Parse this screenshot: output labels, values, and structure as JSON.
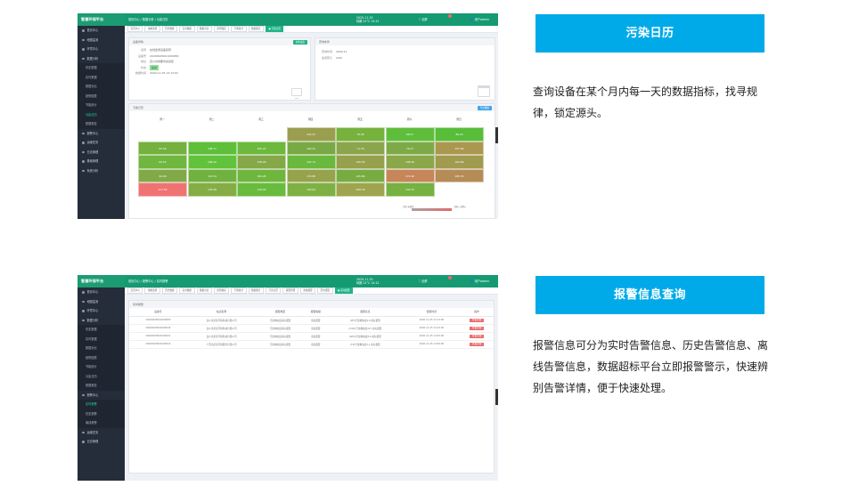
{
  "app": {
    "name": "智慧环保平台",
    "user": "用户admin",
    "fullscreen": "全屏",
    "top_info_line1": "2020-11-25",
    "top_info_line2": "晴朗 22°C 14:12"
  },
  "sidebar": {
    "items": [
      {
        "label": "首页中心",
        "sub": false,
        "on": false
      },
      {
        "label": "地图监测",
        "sub": false,
        "on": false
      },
      {
        "label": "环境中心",
        "sub": false,
        "on": false
      },
      {
        "label": "数据分析",
        "sub": false,
        "on": false
      },
      {
        "label": "历史数据",
        "sub": true,
        "on": false
      },
      {
        "label": "实时数据",
        "sub": true,
        "on": false
      },
      {
        "label": "数据对比",
        "sub": true,
        "on": false
      },
      {
        "label": "趋势图表",
        "sub": true,
        "on": false
      },
      {
        "label": "节能统计",
        "sub": true,
        "on": false
      },
      {
        "label": "污染日历",
        "sub": true,
        "on": true
      },
      {
        "label": "数据报告",
        "sub": true,
        "on": false
      },
      {
        "label": "报警中心",
        "sub": false,
        "on": false
      },
      {
        "label": "运维任务",
        "sub": false,
        "on": false
      },
      {
        "label": "日志管理",
        "sub": false,
        "on": false
      },
      {
        "label": "基础管理",
        "sub": false,
        "on": false
      },
      {
        "label": "系统分析",
        "sub": false,
        "on": false
      }
    ]
  },
  "sidebar2": {
    "items": [
      {
        "label": "首页中心",
        "sub": false,
        "on": false
      },
      {
        "label": "地图监测",
        "sub": false,
        "on": false
      },
      {
        "label": "环境中心",
        "sub": false,
        "on": false
      },
      {
        "label": "数据分析",
        "sub": false,
        "on": false
      },
      {
        "label": "历史数据",
        "sub": true,
        "on": false
      },
      {
        "label": "实时数据",
        "sub": true,
        "on": false
      },
      {
        "label": "数据对比",
        "sub": true,
        "on": false
      },
      {
        "label": "趋势图表",
        "sub": true,
        "on": false
      },
      {
        "label": "节能统计",
        "sub": true,
        "on": false
      },
      {
        "label": "污染日历",
        "sub": true,
        "on": false
      },
      {
        "label": "数据报告",
        "sub": true,
        "on": false
      },
      {
        "label": "报警中心",
        "sub": false,
        "on": false
      },
      {
        "label": "实时报警",
        "sub": true,
        "on": true
      },
      {
        "label": "历史报警",
        "sub": true,
        "on": false
      },
      {
        "label": "离线报警",
        "sub": true,
        "on": false
      },
      {
        "label": "运维任务",
        "sub": false,
        "on": false
      },
      {
        "label": "日志管理",
        "sub": false,
        "on": false
      }
    ]
  },
  "shot1": {
    "crumb": "首页中心 / 数据分析 / 污染日历",
    "tags": [
      {
        "label": "首页中心",
        "on": false
      },
      {
        "label": "地图监测",
        "on": false
      },
      {
        "label": "历史数据",
        "on": false
      },
      {
        "label": "实时数据",
        "on": false
      },
      {
        "label": "数据对比",
        "on": false
      },
      {
        "label": "趋势图表",
        "on": false
      },
      {
        "label": "节能统计",
        "on": false
      },
      {
        "label": "数据报告",
        "on": false
      },
      {
        "label": "● 污染日历",
        "on": true
      }
    ],
    "device_card": {
      "title": "设备详情",
      "button": "切换设备",
      "rows": [
        {
          "k": "名称",
          "v": "在线监测设备名称"
        },
        {
          "k": "设备号",
          "v": "20200925001000056"
        },
        {
          "k": "地址",
          "v": "四川省成都市某某区"
        },
        {
          "k": "状态",
          "v": "在线"
        },
        {
          "k": "数据时间",
          "v": "2020-11-25 14:13:02"
        }
      ]
    },
    "query_card": {
      "title": "查询条件",
      "rows": [
        {
          "k": "查询时间",
          "v": "2020-11"
        },
        {
          "k": "监测因子",
          "v": "COD"
        }
      ]
    },
    "calendar": {
      "title": "污染日历",
      "button": "导出数据",
      "weekdays": [
        "周一",
        "周二",
        "周三",
        "周四",
        "周五",
        "周六",
        "周日"
      ],
      "cells": [
        {
          "r": 0,
          "c": 3,
          "v": "101.22",
          "color": "#9a9f4f"
        },
        {
          "r": 0,
          "c": 4,
          "v": "76.09",
          "color": "#76b23c"
        },
        {
          "r": 0,
          "c": 5,
          "v": "88.57",
          "color": "#5fbd3c"
        },
        {
          "r": 0,
          "c": 6,
          "v": "86.20",
          "color": "#58bd39"
        },
        {
          "r": 1,
          "c": 0,
          "v": "93.46",
          "color": "#74b13f"
        },
        {
          "r": 1,
          "c": 1,
          "v": "108.71",
          "color": "#5fbe3a"
        },
        {
          "r": 1,
          "c": 2,
          "v": "105.22",
          "color": "#6cb93e"
        },
        {
          "r": 1,
          "c": 3,
          "v": "100.21",
          "color": "#79a945"
        },
        {
          "r": 1,
          "c": 4,
          "v": "71.76",
          "color": "#8ba54c"
        },
        {
          "r": 1,
          "c": 5,
          "v": "70.27",
          "color": "#7daa47"
        },
        {
          "r": 1,
          "c": 6,
          "v": "157.00",
          "color": "#aa9750"
        },
        {
          "r": 2,
          "c": 0,
          "v": "94.53",
          "color": "#6fb73f"
        },
        {
          "r": 2,
          "c": 1,
          "v": "106.22",
          "color": "#61c33b"
        },
        {
          "r": 2,
          "c": 2,
          "v": "138.29",
          "color": "#85a849"
        },
        {
          "r": 2,
          "c": 3,
          "v": "142.74",
          "color": "#6ab83d"
        },
        {
          "r": 2,
          "c": 4,
          "v": "140.30",
          "color": "#95a14d"
        },
        {
          "r": 2,
          "c": 5,
          "v": "148.40",
          "color": "#8aa74a"
        },
        {
          "r": 2,
          "c": 6,
          "v": "164.89",
          "color": "#a19b50"
        },
        {
          "r": 3,
          "c": 0,
          "v": "94.48",
          "color": "#82a948"
        },
        {
          "r": 3,
          "c": 1,
          "v": "110.34",
          "color": "#70b13f"
        },
        {
          "r": 3,
          "c": 2,
          "v": "100.28",
          "color": "#6fb63f"
        },
        {
          "r": 3,
          "c": 3,
          "v": "170.88",
          "color": "#97a24c"
        },
        {
          "r": 3,
          "c": 4,
          "v": "145.80",
          "color": "#78ac43"
        },
        {
          "r": 3,
          "c": 5,
          "v": "172.40",
          "color": "#c6865a"
        },
        {
          "r": 3,
          "c": 6,
          "v": "185.53",
          "color": "#b58c56"
        },
        {
          "r": 4,
          "c": 0,
          "v": "217.50",
          "color": "#f07373"
        },
        {
          "r": 4,
          "c": 1,
          "v": "135.58",
          "color": "#85ad45"
        },
        {
          "r": 4,
          "c": 2,
          "v": "119.20",
          "color": "#69bb3d"
        },
        {
          "r": 4,
          "c": 3,
          "v": "140.64",
          "color": "#7fb044"
        },
        {
          "r": 4,
          "c": 4,
          "v": "208.78",
          "color": "#9ea54e"
        },
        {
          "r": 4,
          "c": 5,
          "v": "134.52",
          "color": "#76b141"
        }
      ],
      "legend_low": "合格 未超标",
      "legend_high": "超标 已超标"
    }
  },
  "shot2": {
    "crumb": "首页中心 / 报警中心 / 实时报警",
    "tags": [
      {
        "label": "首页中心",
        "on": false
      },
      {
        "label": "地图监测",
        "on": false
      },
      {
        "label": "历史数据",
        "on": false
      },
      {
        "label": "实时数据",
        "on": false
      },
      {
        "label": "数据对比",
        "on": false
      },
      {
        "label": "趋势图表",
        "on": false
      },
      {
        "label": "节能统计",
        "on": false
      },
      {
        "label": "数据报告",
        "on": false
      },
      {
        "label": "污染日历",
        "on": false
      },
      {
        "label": "报警管理",
        "on": false
      },
      {
        "label": "离线报警",
        "on": false
      },
      {
        "label": "历史报警",
        "on": false
      },
      {
        "label": "● 实时报警",
        "on": true
      }
    ],
    "table": {
      "title": "实时报警",
      "columns": [
        "设备号",
        "站点名称",
        "报警类型",
        "报警等级",
        "报警信息",
        "报警时间",
        "操作"
      ],
      "rows": [
        [
          "20200925001000083",
          "四川省某某环保科技有限公司",
          "污染物浓度超标报警",
          "重度报警",
          "(PH)污染物浓度9.8 超标报警",
          "2020-11-25 14:13:00",
          "查看详情"
        ],
        [
          "20200925001000045",
          "四川省某某环保科技有限公司",
          "污染物浓度超标报警",
          "重度报警",
          "(COD)污染物浓度217 超标报警",
          "2020-11-25 14:10:00",
          "查看详情"
        ],
        [
          "20200925001000021",
          "四川省某某环保科技有限公司",
          "污染物浓度超标报警",
          "重度报警",
          "(NH3)污染物浓度8.6 超标报警",
          "2020-11-25 14:05:00",
          "查看详情"
        ],
        [
          "20200925001000016",
          "广西省某某环保服务有限公司",
          "污染物浓度超标报警",
          "重度报警",
          "(TP)污染物浓度3.1 超标报警",
          "2020-11-25 14:00:00",
          "查看详情"
        ]
      ]
    }
  },
  "sections": [
    {
      "title": "污染日历",
      "desc": "查询设备在某个月内每一天的数据指标，找寻规律，锁定源头。"
    },
    {
      "title": "报警信息查询",
      "desc": "报警信息可分为实时告警信息、历史告警信息、离线告警信息，数据超标平台立即报警警示，快速辨别告警详情，便于快速处理。"
    }
  ]
}
